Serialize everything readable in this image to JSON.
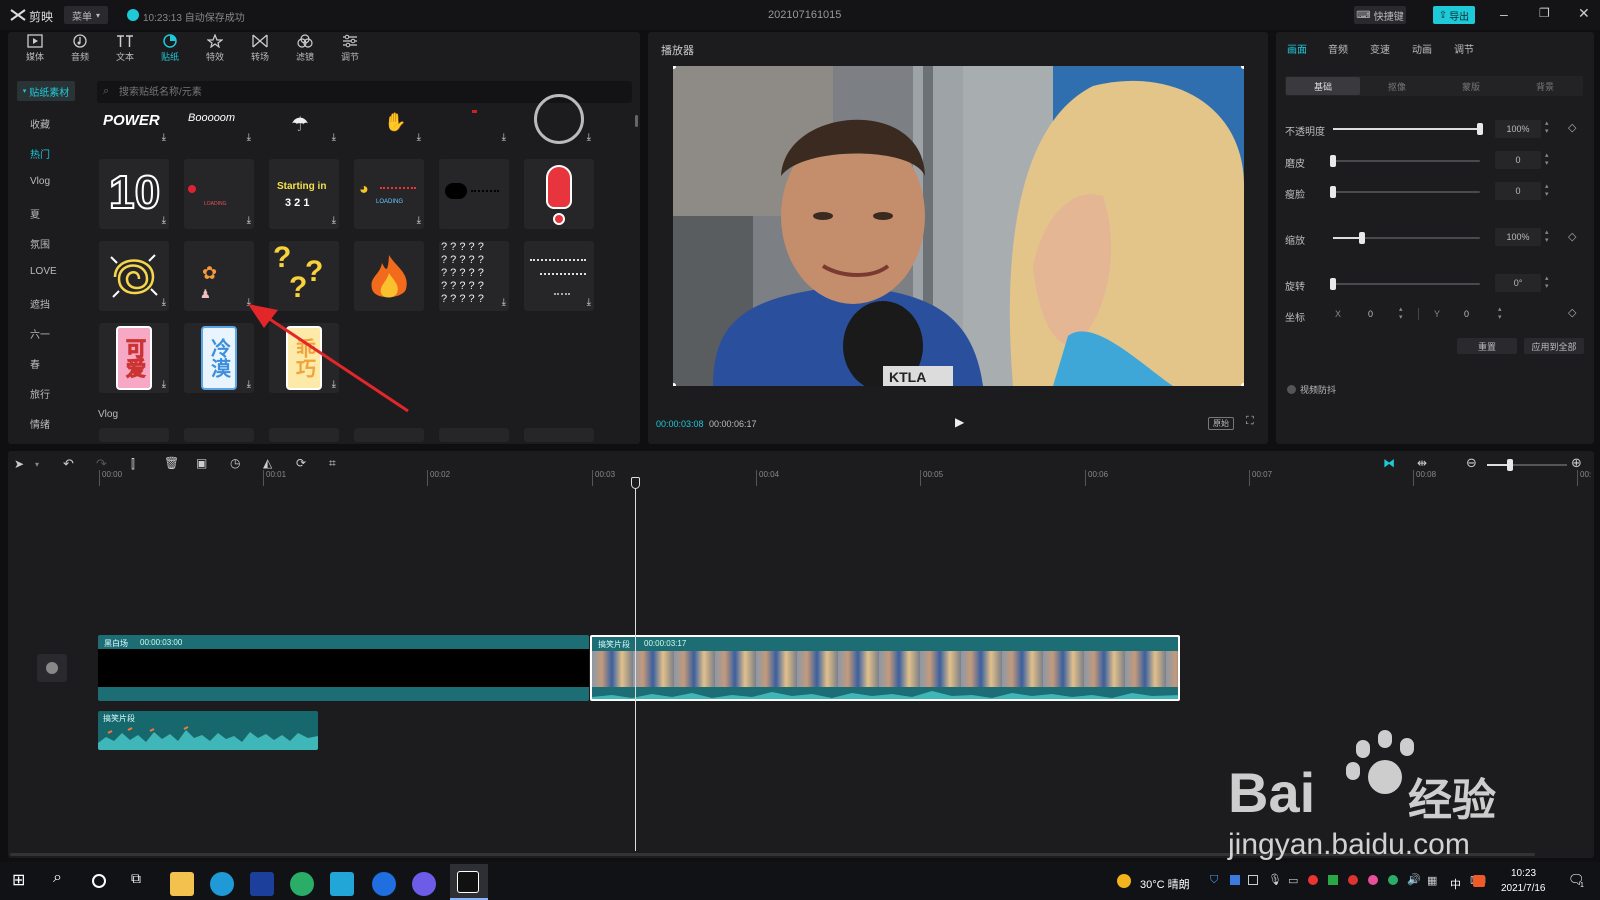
{
  "titlebar": {
    "app_name": "剪映",
    "menu_label": "菜单",
    "autosave": "10:23:13 自动保存成功",
    "project_name": "202107161015",
    "shortcut_label": "快捷键",
    "export_label": "导出"
  },
  "toolbar": {
    "items": [
      {
        "label": "媒体"
      },
      {
        "label": "音频"
      },
      {
        "label": "文本"
      },
      {
        "label": "贴纸"
      },
      {
        "label": "特效"
      },
      {
        "label": "转场"
      },
      {
        "label": "滤镜"
      },
      {
        "label": "调节"
      }
    ]
  },
  "sticker_panel": {
    "section_button": "贴纸素材",
    "search_placeholder": "搜索贴纸名称/元素",
    "categories": [
      "收藏",
      "热门",
      "Vlog",
      "夏",
      "氛围",
      "LOVE",
      "遮挡",
      "六一",
      "春",
      "旅行",
      "情绪"
    ],
    "active_category": "热门",
    "section_label_vlog": "Vlog",
    "sticker_texts": {
      "power": "POWER",
      "boom": "Booooom",
      "ten": "10",
      "starting": "Starting in",
      "countdown": "3 2 1",
      "loading": "LOADING",
      "loading_small": "LOADING",
      "question_grid": "? ? ? ? ?",
      "keai": "可爱",
      "lengmo": "冷漠",
      "guaiqiao": "乖巧"
    }
  },
  "player": {
    "title": "播放器",
    "current_time": "00:00:03:08",
    "total_time": "00:00:06:17",
    "ratio_label": "原始",
    "mic_text": "KTLA"
  },
  "properties": {
    "tabs": [
      "画面",
      "音频",
      "变速",
      "动画",
      "调节"
    ],
    "active_tab": "画面",
    "subtabs": [
      "基础",
      "抠像",
      "蒙版",
      "背景"
    ],
    "opacity": {
      "label": "不透明度",
      "value": "100%",
      "level": 1.0
    },
    "smooth": {
      "label": "磨皮",
      "value": "0",
      "level": 0
    },
    "thin": {
      "label": "瘦脸",
      "value": "0",
      "level": 0
    },
    "scale": {
      "label": "缩放",
      "value": "100%",
      "level": 0.2
    },
    "rotate": {
      "label": "旋转",
      "value": "0°",
      "level": 0
    },
    "position": {
      "label": "坐标",
      "x_label": "X",
      "x_value": "0",
      "y_label": "Y",
      "y_value": "0"
    },
    "reset_label": "重置",
    "apply_all_label": "应用到全部",
    "stabilize_label": "视频防抖"
  },
  "timeline": {
    "ticks": [
      "00:00",
      "00:01",
      "00:02",
      "00:03",
      "00:04",
      "00:05",
      "00:06",
      "00:07",
      "00:08",
      "00:"
    ],
    "clip_black": {
      "name": "黑白场",
      "duration": "00:00:03:00"
    },
    "clip_video": {
      "name": "搞笑片段",
      "duration": "00:00:03:17"
    },
    "clip_audio": {
      "name": "搞笑片段"
    }
  },
  "taskbar": {
    "weather": "30°C 晴朗",
    "ime": "中",
    "time": "10:23",
    "date": "2021/7/16",
    "notification_count": "1"
  },
  "watermark": {
    "brand": "Bai",
    "brand_cn": "经验",
    "url": "jingyan.baidu.com"
  },
  "colors": {
    "accent": "#1ec9d8",
    "clip_teal": "#1c6d74",
    "audio_teal": "#17686d"
  }
}
